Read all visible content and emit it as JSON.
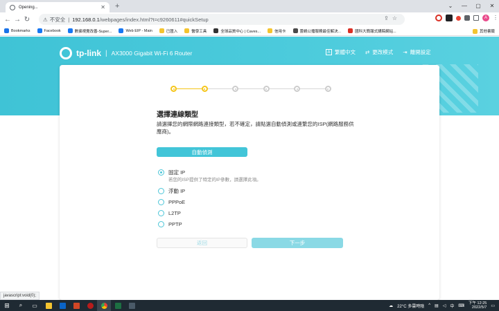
{
  "browser": {
    "tab_title": "Opening...",
    "url_warning": "不安全",
    "url_host": "192.168.0.1",
    "url_path": "/webpages/index.html?t=c9260611#quickSetup"
  },
  "bookmarks": [
    {
      "label": "Bookmarks",
      "color": "#1a73e8"
    },
    {
      "label": "Facebook",
      "color": "#1877f2"
    },
    {
      "label": "數據視覺改善-Super...",
      "color": "#1877f2"
    },
    {
      "label": "Web EIP - Main",
      "color": "#1877f2"
    },
    {
      "label": "已匯入",
      "color": "#f4c430"
    },
    {
      "label": "醫學工具",
      "color": "#f4c430"
    },
    {
      "label": "全球品質中心 | Caves...",
      "color": "#333333"
    },
    {
      "label": "信用卡",
      "color": "#f4c430"
    },
    {
      "label": "蕾蝸公播服務最佳解決...",
      "color": "#4a4a4a"
    },
    {
      "label": "國科大簡報式講稿網站...",
      "color": "#d93025"
    }
  ],
  "bookmarks_other": "其他書籤",
  "header": {
    "brand": "tp-link",
    "separator": "|",
    "model": "AX3000 Gigabit Wi-Fi 6 Router",
    "nav": [
      {
        "label": "繁體中文",
        "icon": "language-icon"
      },
      {
        "label": "更改模式",
        "icon": "change-mode-icon"
      },
      {
        "label": "離開設定",
        "icon": "exit-icon"
      }
    ]
  },
  "wizard": {
    "step_total": 6,
    "step_current": 2,
    "title": "選擇連線類型",
    "description": "請選擇您的網際網路連接類型，若不確定，請點選自動偵測或連繫您的ISP(網路服務供應商)。",
    "auto_detect": "自動偵測",
    "options": [
      {
        "label": "固定 IP",
        "selected": true,
        "hint": "若您的ISP提供了特定的IP參數，請選擇此項。"
      },
      {
        "label": "浮動 IP",
        "selected": false,
        "hint": ""
      },
      {
        "label": "PPPoE",
        "selected": false,
        "hint": ""
      },
      {
        "label": "L2TP",
        "selected": false,
        "hint": ""
      },
      {
        "label": "PPTP",
        "selected": false,
        "hint": ""
      }
    ],
    "back": "返回",
    "next": "下一步"
  },
  "status_bar": "javascript:void(0);",
  "taskbar": {
    "weather": "22°C 多雲時陰",
    "ime": "中",
    "time": "下午 12:25",
    "date": "2022/5/7"
  },
  "colors": {
    "accent": "#42c5d8",
    "step_active": "#f5c518"
  }
}
